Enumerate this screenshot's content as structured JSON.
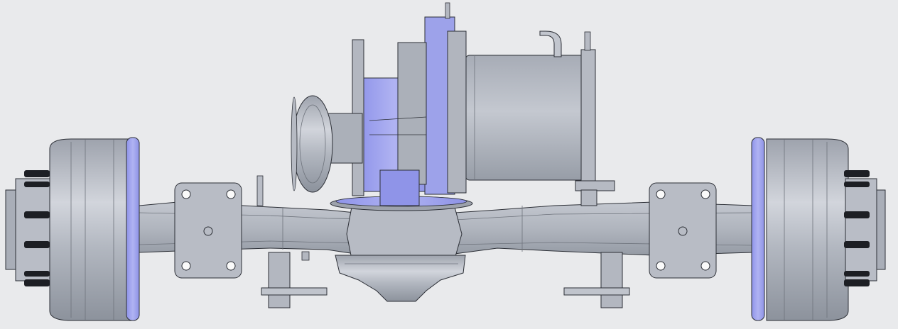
{
  "scene": {
    "subject": "",
    "colors": {
      "background": "#e9eaec",
      "metal": "#a9aeb8",
      "metal_light": "#c6cad2",
      "metal_dark": "#8a909b",
      "edge": "#2c2f36",
      "highlight": "#9b9ff0",
      "bolt": "#1d1f24"
    }
  }
}
